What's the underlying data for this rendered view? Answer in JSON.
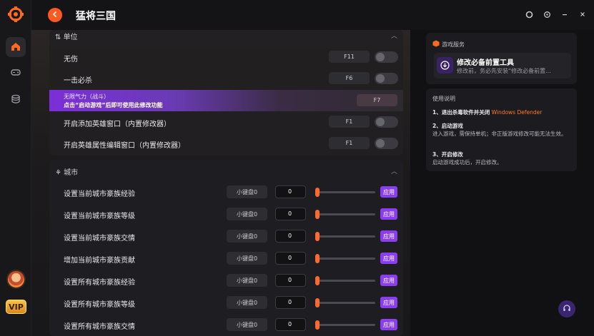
{
  "window": {
    "title": "猛将三国"
  },
  "colors": {
    "accent_orange": "#ff5a1f",
    "accent_purple": "#8b3df0",
    "bg": "#111113"
  },
  "rail": {
    "items": [
      {
        "icon": "home-icon",
        "active": true
      },
      {
        "icon": "gamepad-icon",
        "active": false
      },
      {
        "icon": "database-icon",
        "active": false
      }
    ],
    "vip_label": "VIP"
  },
  "unit_section": {
    "title": "单位",
    "rows": [
      {
        "label": "无伤",
        "hotkey": "F11"
      },
      {
        "label": "一击必杀",
        "hotkey": "F6"
      }
    ],
    "promo": {
      "line1": "无限气力（战斗）",
      "line2": "点击“启动游戏”后即可使用此修改功能",
      "hotkey": "F7"
    },
    "rows2": [
      {
        "label": "开启添加英雄窗口（内置修改器）",
        "hotkey": "F1"
      },
      {
        "label": "开启英雄属性编辑窗口（内置修改器）",
        "hotkey": "F1"
      }
    ]
  },
  "city_section": {
    "title": "城市",
    "rows": [
      {
        "label": "设置当前城市豪族经验",
        "keypad": "小键盘0",
        "value": "0",
        "apply": "应用"
      },
      {
        "label": "设置当前城市豪族等级",
        "keypad": "小键盘0",
        "value": "0",
        "apply": "应用"
      },
      {
        "label": "设置当前城市豪族交情",
        "keypad": "小键盘0",
        "value": "0",
        "apply": "应用"
      },
      {
        "label": "增加当前城市豪族贡献",
        "keypad": "小键盘0",
        "value": "0",
        "apply": "应用"
      },
      {
        "label": "设置所有城市豪族经验",
        "keypad": "小键盘0",
        "value": "0",
        "apply": "应用"
      },
      {
        "label": "设置所有城市豪族等级",
        "keypad": "小键盘0",
        "value": "0",
        "apply": "应用"
      },
      {
        "label": "设置所有城市豪族交情",
        "keypad": "小键盘0",
        "value": "0",
        "apply": "应用"
      }
    ]
  },
  "service": {
    "title": "游戏服务",
    "item_name": "修改必备前置工具",
    "item_desc": "修改前，务必先安装“修改必备前置..."
  },
  "guide": {
    "title": "使用说明",
    "s1_title": "1、退出杀毒软件并关闭",
    "s1_highlight": "Windows Defender",
    "s2_title": "2、启动游戏",
    "s2_text": "进入游戏，需保持单机；非正版游戏修改可能无法生效。",
    "s3_title": "3、开启修改",
    "s3_text": "启动游戏成功后，开启修改。"
  }
}
